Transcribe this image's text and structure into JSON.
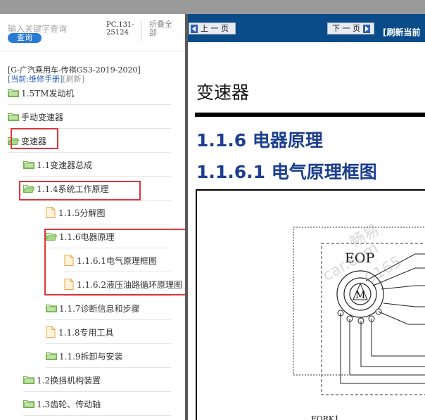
{
  "left_panel": {
    "search_placeholder": "输入关键字查询",
    "search_button": "查询",
    "pc_code": "PC.131-25124",
    "collapse_all": "折叠全部",
    "book_title": "[G-广汽乘用车-传祺GS3-2019-2020]",
    "current_label": "[当前:",
    "current_link": "维修手册",
    "current_close": "]",
    "refresh": "[刷新]",
    "tree": [
      {
        "label": "1.5TM发动机",
        "icon": "folder-closed"
      },
      {
        "label": "手动变速器",
        "icon": "folder-closed"
      },
      {
        "label": "变速器",
        "icon": "folder-open"
      },
      {
        "label": "1.1变速器总成",
        "icon": "folder-closed"
      },
      {
        "label": "1.1.4系统工作原理",
        "icon": "folder-open"
      },
      {
        "label": "1.1.5分解图",
        "icon": "document"
      },
      {
        "label": "1.1.6电器原理",
        "icon": "folder-open"
      },
      {
        "label": "1.1.6.1电气原理框图",
        "icon": "document"
      },
      {
        "label": "1.1.6.2液压油路循环原理图",
        "icon": "document"
      },
      {
        "label": "1.1.7诊断信息和步骤",
        "icon": "folder-closed"
      },
      {
        "label": "1.1.8专用工具",
        "icon": "document"
      },
      {
        "label": "1.1.9拆卸与安装",
        "icon": "folder-closed"
      },
      {
        "label": "1.2换挡机构装置",
        "icon": "folder-closed"
      },
      {
        "label": "1.3齿轮、传动轴",
        "icon": "folder-closed"
      }
    ]
  },
  "toolbar": {
    "prev_label": "上 一 页",
    "next_label": "下 一 页",
    "refresh_page": "[刷新当前"
  },
  "content": {
    "page_title": "变速器",
    "section_title": "1.1.6 电器原理",
    "subsection_title": "1.1.6.1 电气原理框图",
    "diagram": {
      "eop_label": "EOP",
      "motor_label": "M",
      "fork_label": "FORK1",
      "pin_labels": [
        "1",
        "2",
        "3",
        "3",
        "1"
      ]
    },
    "watermarks": [
      "畅易",
      "car.com",
      "0165"
    ]
  },
  "colors": {
    "navbar": "#0a4b8a",
    "accent": "#2a7ad2",
    "heading": "#1c3e8e",
    "highlight_box": "#e0353a",
    "folder": "#7cc05a",
    "document": "#f0b45a"
  }
}
